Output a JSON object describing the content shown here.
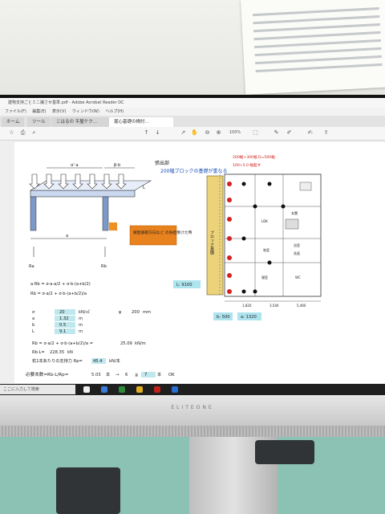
{
  "window": {
    "title": "建物支持ごとミニ撮させ基準.pdf - Adobe Acrobat Reader DC",
    "menus": [
      "ファイル(F)",
      "編集(E)",
      "表示(V)",
      "ウィンドウ(W)",
      "ヘルプ(H)"
    ],
    "tabs": [
      "ホーム",
      "ツール",
      "こはるの 平屋ケク...",
      "堀心基礎の検討..."
    ]
  },
  "toolbar": {
    "zoom": "100%",
    "icons": [
      "star-icon",
      "print-icon",
      "search-icon",
      "up-icon",
      "down-icon",
      "cursor-icon",
      "hand-icon",
      "zoom-out-icon",
      "zoom-in-icon",
      "fit-icon",
      "comment-icon",
      "pen-icon",
      "sign-icon",
      "share-icon"
    ]
  },
  "document": {
    "heading_labels": {
      "overhang": "張出部",
      "block_foundation_note": "200幅ブロックの基礎が重なる",
      "red_note_1": "200幅+300幅 D=500幅",
      "red_note_2": "100+5.0 幅超す",
      "block_label": "ブロック基礎",
      "wall_note": "擁壁基礎方向など\nの負担受けた時",
      "L_label": "L",
      "dim_a": "a",
      "dim_alpha": "α'·a",
      "dim_beta": "β·b",
      "Ra": "Ra",
      "Rb": "Rb"
    },
    "formulas": [
      "a·Rb = σ·a·a/2 + σ·b·(a+b/2)",
      "Rb = σ·a/2 + σ·b·(a+b/2)/a"
    ],
    "param_table": [
      {
        "name": "σ",
        "value": "20",
        "unit": "kN/㎡"
      },
      {
        "name": "a",
        "value": "1.32",
        "unit": "m"
      },
      {
        "name": "b",
        "value": "0.5",
        "unit": "m"
      },
      {
        "name": "L",
        "value": "9.1",
        "unit": "m"
      }
    ],
    "phi": {
      "label": "φ",
      "value": "200",
      "unit": "mm"
    },
    "rb_result": {
      "expr": "Rb = σ·a/2 + σ·b·(a+b/2)/a =",
      "value": "25.09",
      "unit": "kN/m"
    },
    "rb_total": {
      "label": "Rb·L=",
      "value": "228.35",
      "unit": "kN"
    },
    "pile_support": {
      "label": "杭1本あたりの支持力 Rp=",
      "value": "45.4",
      "unit": "kN/本"
    },
    "required": {
      "label": "必要本数=Rb·L/Rp=",
      "value": "5.03",
      "unit": "本",
      "arrow": "→",
      "count": "6",
      "le": "≦",
      "cmp": "7",
      "unit2": "本",
      "ok": "OK"
    },
    "plan_dims": {
      "L_value": "L: 9100",
      "b_value": "b: 500",
      "a_value": "a: 1320",
      "dims_bottom": [
        "1,820",
        "3,540",
        "5,460"
      ],
      "room_labels": [
        "玄関",
        "LDK",
        "和室",
        "浴室",
        "洗面",
        "寝室",
        "WC"
      ]
    }
  },
  "taskbar": {
    "search_placeholder": "ここに入力して検索"
  },
  "monitor": {
    "brand": "ELITEONE"
  }
}
